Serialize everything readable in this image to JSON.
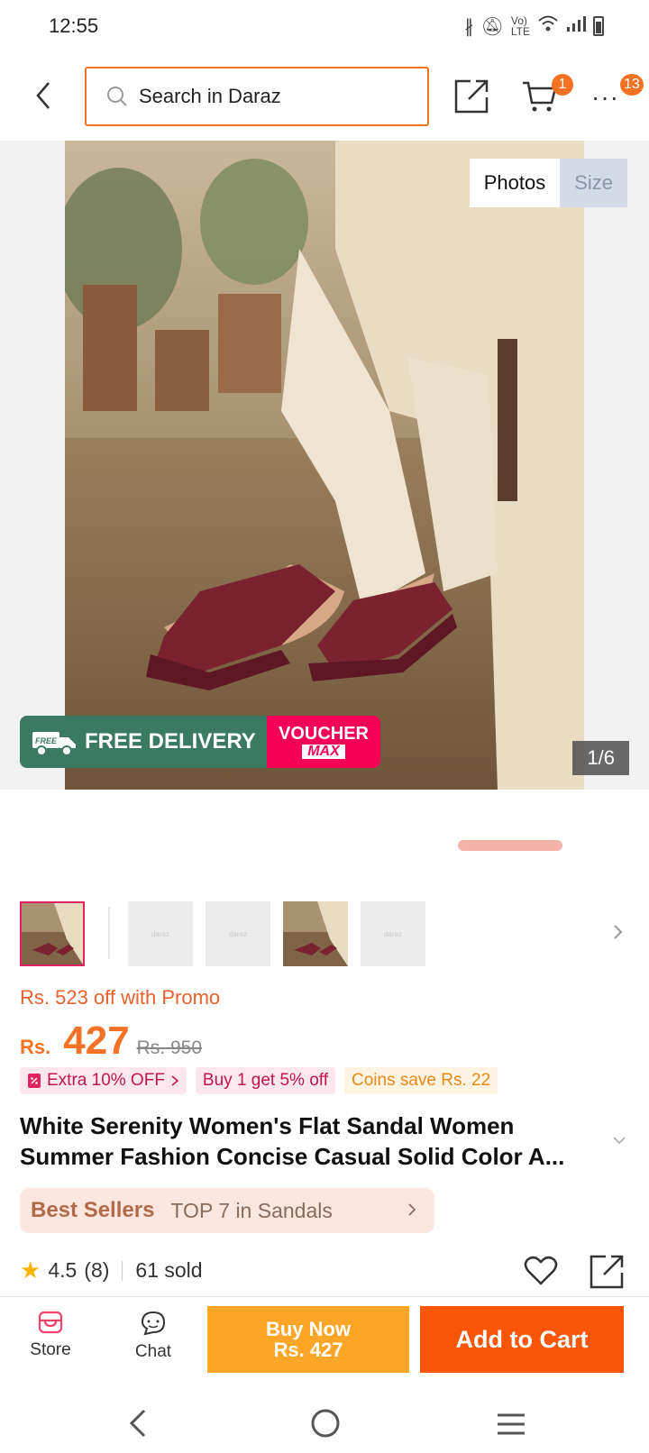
{
  "status_bar": {
    "time": "12:55"
  },
  "search": {
    "placeholder": "Search in Daraz"
  },
  "nav": {
    "cart_count": "1",
    "more_count": "13"
  },
  "gallery": {
    "tab_photos": "Photos",
    "tab_size": "Size",
    "counter": "1/6",
    "banner_free_delivery": "FREE DELIVERY",
    "banner_free_tag": "FREE",
    "banner_voucher": "VOUCHER",
    "banner_max": "MAX"
  },
  "thumbnails": {
    "placeholder_text": "daraz"
  },
  "product": {
    "promo_off": "Rs. 523 off with Promo",
    "currency": "Rs.",
    "price": "427",
    "old_price": "Rs. 950",
    "chips": {
      "extra": "Extra 10% OFF",
      "buy": "Buy 1 get 5% off",
      "coins": "Coins save Rs. 22"
    },
    "title": "White Serenity Women's Flat Sandal Women Summer Fashion Concise Casual Solid Color A...",
    "best_sellers": {
      "label": "Best Sellers",
      "rank": "TOP 7 in Sandals"
    },
    "rating": "4.5",
    "reviews": "(8)",
    "sold": "61 sold"
  },
  "bottom_bar": {
    "store": "Store",
    "chat": "Chat",
    "buy_now": "Buy Now",
    "buy_now_price": "Rs. 427",
    "add_to_cart": "Add to Cart"
  },
  "colors": {
    "brand": "#f57224",
    "add_to_cart": "#f85606",
    "buy_now": "#fca526",
    "voucher": "#f50057",
    "free_delivery": "#3a7a63"
  }
}
